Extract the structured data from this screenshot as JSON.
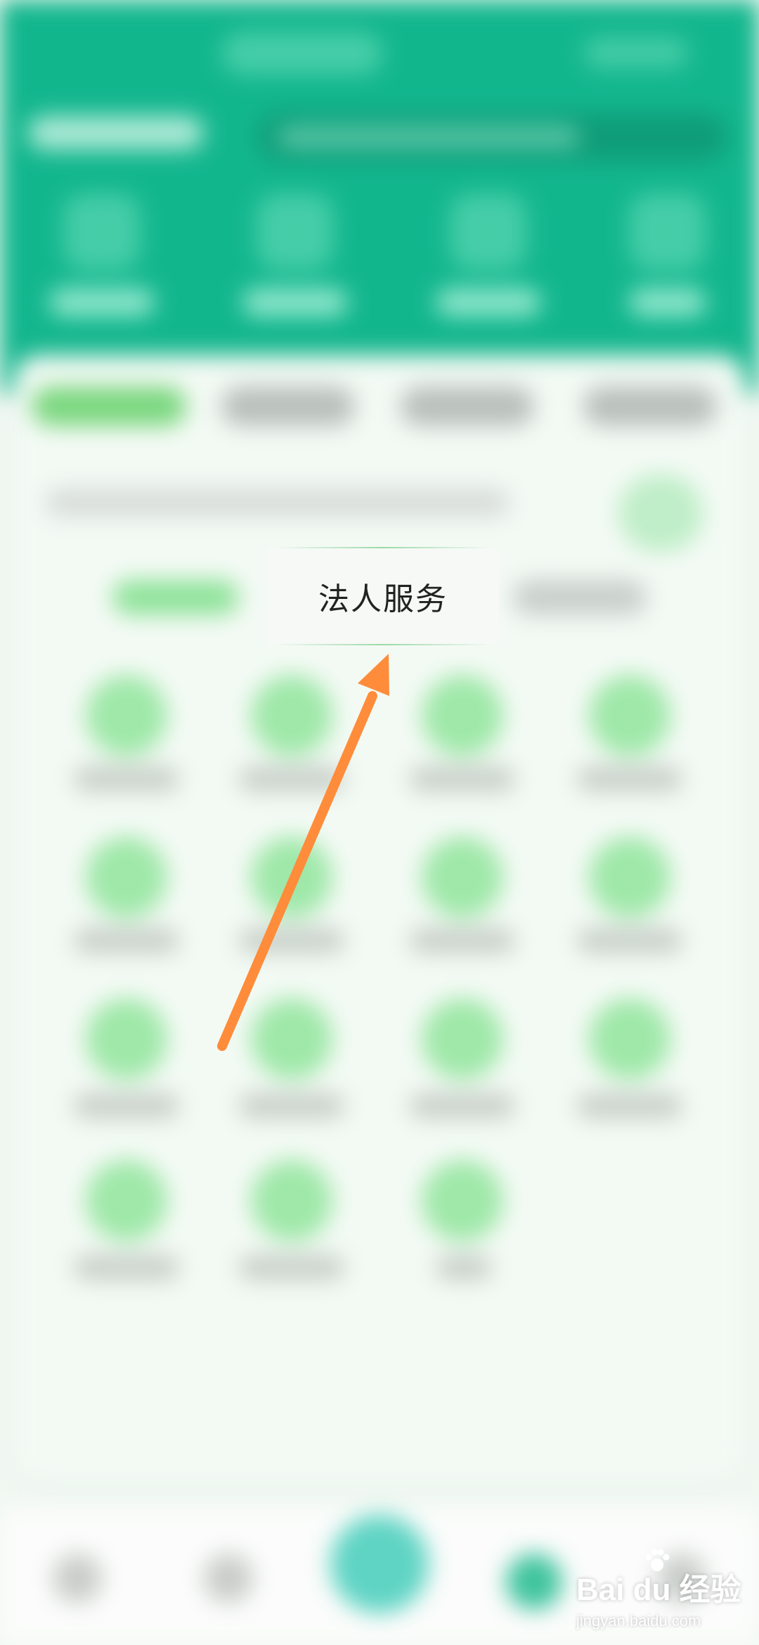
{
  "popup": {
    "label": "法人服务"
  },
  "watermark": {
    "brand": "Bai du 经验",
    "url": "jingyan.baidu.com"
  },
  "colors": {
    "header": "#12b68d",
    "card": "#f3faf4",
    "icon_green": "#9fe8a9",
    "arrow": "#ff8c3a"
  },
  "icons": {
    "arrow": "arrow-pointer-icon",
    "paw": "paw-icon"
  }
}
